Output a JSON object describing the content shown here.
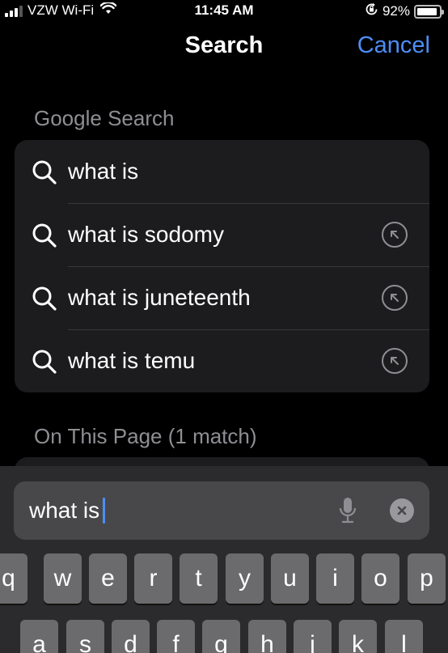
{
  "status_bar": {
    "carrier": "VZW Wi-Fi",
    "time": "11:45 AM",
    "battery_percent": "92%",
    "battery_level": 0.92
  },
  "nav": {
    "title": "Search",
    "cancel_label": "Cancel"
  },
  "google_section": {
    "header": "Google Search",
    "suggestions": [
      {
        "text": "what is",
        "has_fill_arrow": false
      },
      {
        "text": "what is sodomy",
        "has_fill_arrow": true
      },
      {
        "text": "what is juneteenth",
        "has_fill_arrow": true
      },
      {
        "text": "what is temu",
        "has_fill_arrow": true
      }
    ]
  },
  "page_section": {
    "header": "On This Page (1 match)"
  },
  "search_field": {
    "value": "what is"
  },
  "keyboard": {
    "row1": [
      "q",
      "w",
      "e",
      "r",
      "t",
      "y",
      "u",
      "i",
      "o",
      "p"
    ],
    "row2": [
      "a",
      "s",
      "d",
      "f",
      "g",
      "h",
      "j",
      "k",
      "l"
    ]
  },
  "colors": {
    "accent": "#4c8ef7",
    "background": "#000000",
    "card": "#1c1c1e",
    "secondary_text": "#8e8e93"
  }
}
